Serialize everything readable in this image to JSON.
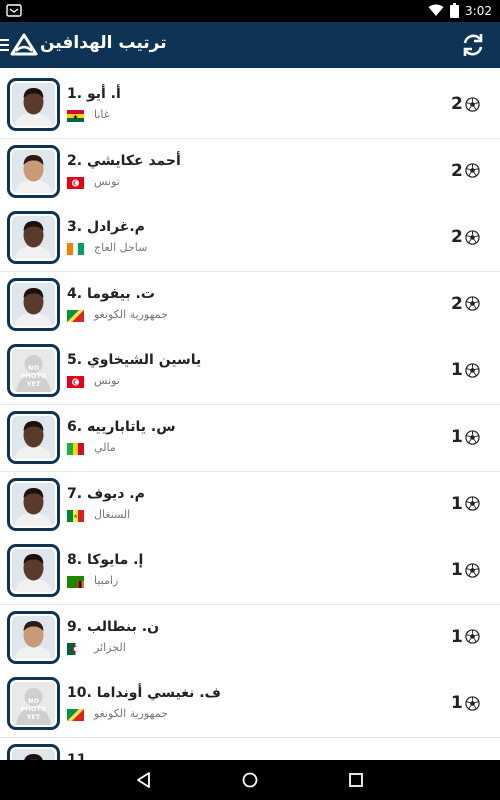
{
  "status_bar": {
    "time": "3:02",
    "icons": [
      "app-notification-icon",
      "wifi-icon",
      "battery-icon"
    ]
  },
  "app_bar": {
    "title": "ترتيب الهدافين",
    "icons": [
      "menu-icon",
      "app-logo-icon",
      "refresh-icon"
    ],
    "color": "#0f3355"
  },
  "players": [
    {
      "rank": "1.",
      "name": "أ. أيو",
      "country": "غانا",
      "flag": "ghana",
      "goals": "2",
      "photo": "dark-face"
    },
    {
      "rank": "2.",
      "name": "أحمد عكايشي",
      "country": "تونس",
      "flag": "tunisia",
      "goals": "2",
      "photo": "light-face"
    },
    {
      "rank": "3.",
      "name": "م.غرادل",
      "country": "ساحل العاج",
      "flag": "ivory-coast",
      "goals": "2",
      "photo": "dark-face"
    },
    {
      "rank": "4.",
      "name": "ت. بيفوما",
      "country": "جمهورية الكونغو",
      "flag": "congo",
      "goals": "2",
      "photo": "dark-face"
    },
    {
      "rank": "5.",
      "name": "ياسين الشيخاوي",
      "country": "تونس",
      "flag": "tunisia",
      "goals": "1",
      "photo": "no-photo"
    },
    {
      "rank": "6.",
      "name": "س. ياتابارييه",
      "country": "مالي",
      "flag": "mali",
      "goals": "1",
      "photo": "dark-face"
    },
    {
      "rank": "7.",
      "name": "م. ديوف",
      "country": "السنغال",
      "flag": "senegal",
      "goals": "1",
      "photo": "dark-face"
    },
    {
      "rank": "8.",
      "name": "إ. مايوكا",
      "country": "زامبيا",
      "flag": "zambia",
      "goals": "1",
      "photo": "dark-face"
    },
    {
      "rank": "9.",
      "name": "ن. بنطالب",
      "country": "الجزائر",
      "flag": "algeria",
      "goals": "1",
      "photo": "light-face"
    },
    {
      "rank": "10.",
      "name": "ف. نغيسي أونداما",
      "country": "جمهورية الكونغو",
      "flag": "congo",
      "goals": "1",
      "photo": "no-photo"
    },
    {
      "rank": "11.",
      "name": "",
      "country": "",
      "flag": "",
      "goals": "",
      "photo": "dark-face"
    }
  ],
  "no_photo_text": [
    "NO",
    "PHOTO",
    "YET"
  ],
  "nav_bar": {
    "icons": [
      "back-icon",
      "home-icon",
      "recents-icon"
    ]
  }
}
